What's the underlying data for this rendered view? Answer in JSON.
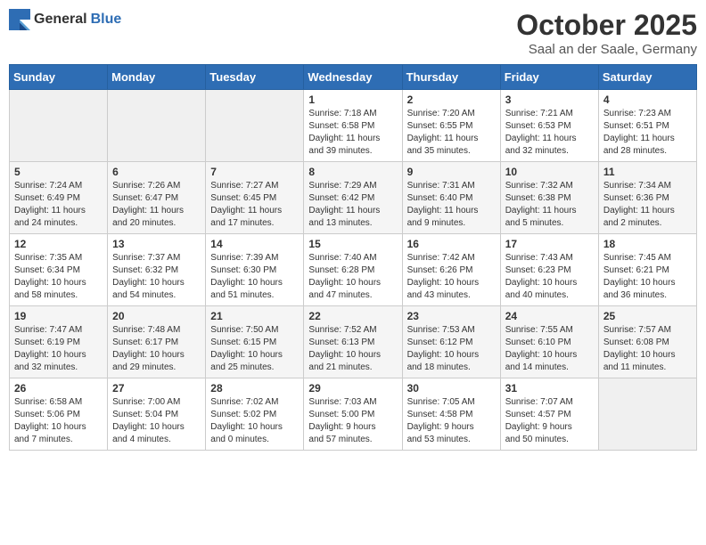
{
  "header": {
    "logo_general": "General",
    "logo_blue": "Blue",
    "month": "October 2025",
    "location": "Saal an der Saale, Germany"
  },
  "weekdays": [
    "Sunday",
    "Monday",
    "Tuesday",
    "Wednesday",
    "Thursday",
    "Friday",
    "Saturday"
  ],
  "weeks": [
    [
      {
        "day": "",
        "info": ""
      },
      {
        "day": "",
        "info": ""
      },
      {
        "day": "",
        "info": ""
      },
      {
        "day": "1",
        "info": "Sunrise: 7:18 AM\nSunset: 6:58 PM\nDaylight: 11 hours\nand 39 minutes."
      },
      {
        "day": "2",
        "info": "Sunrise: 7:20 AM\nSunset: 6:55 PM\nDaylight: 11 hours\nand 35 minutes."
      },
      {
        "day": "3",
        "info": "Sunrise: 7:21 AM\nSunset: 6:53 PM\nDaylight: 11 hours\nand 32 minutes."
      },
      {
        "day": "4",
        "info": "Sunrise: 7:23 AM\nSunset: 6:51 PM\nDaylight: 11 hours\nand 28 minutes."
      }
    ],
    [
      {
        "day": "5",
        "info": "Sunrise: 7:24 AM\nSunset: 6:49 PM\nDaylight: 11 hours\nand 24 minutes."
      },
      {
        "day": "6",
        "info": "Sunrise: 7:26 AM\nSunset: 6:47 PM\nDaylight: 11 hours\nand 20 minutes."
      },
      {
        "day": "7",
        "info": "Sunrise: 7:27 AM\nSunset: 6:45 PM\nDaylight: 11 hours\nand 17 minutes."
      },
      {
        "day": "8",
        "info": "Sunrise: 7:29 AM\nSunset: 6:42 PM\nDaylight: 11 hours\nand 13 minutes."
      },
      {
        "day": "9",
        "info": "Sunrise: 7:31 AM\nSunset: 6:40 PM\nDaylight: 11 hours\nand 9 minutes."
      },
      {
        "day": "10",
        "info": "Sunrise: 7:32 AM\nSunset: 6:38 PM\nDaylight: 11 hours\nand 5 minutes."
      },
      {
        "day": "11",
        "info": "Sunrise: 7:34 AM\nSunset: 6:36 PM\nDaylight: 11 hours\nand 2 minutes."
      }
    ],
    [
      {
        "day": "12",
        "info": "Sunrise: 7:35 AM\nSunset: 6:34 PM\nDaylight: 10 hours\nand 58 minutes."
      },
      {
        "day": "13",
        "info": "Sunrise: 7:37 AM\nSunset: 6:32 PM\nDaylight: 10 hours\nand 54 minutes."
      },
      {
        "day": "14",
        "info": "Sunrise: 7:39 AM\nSunset: 6:30 PM\nDaylight: 10 hours\nand 51 minutes."
      },
      {
        "day": "15",
        "info": "Sunrise: 7:40 AM\nSunset: 6:28 PM\nDaylight: 10 hours\nand 47 minutes."
      },
      {
        "day": "16",
        "info": "Sunrise: 7:42 AM\nSunset: 6:26 PM\nDaylight: 10 hours\nand 43 minutes."
      },
      {
        "day": "17",
        "info": "Sunrise: 7:43 AM\nSunset: 6:23 PM\nDaylight: 10 hours\nand 40 minutes."
      },
      {
        "day": "18",
        "info": "Sunrise: 7:45 AM\nSunset: 6:21 PM\nDaylight: 10 hours\nand 36 minutes."
      }
    ],
    [
      {
        "day": "19",
        "info": "Sunrise: 7:47 AM\nSunset: 6:19 PM\nDaylight: 10 hours\nand 32 minutes."
      },
      {
        "day": "20",
        "info": "Sunrise: 7:48 AM\nSunset: 6:17 PM\nDaylight: 10 hours\nand 29 minutes."
      },
      {
        "day": "21",
        "info": "Sunrise: 7:50 AM\nSunset: 6:15 PM\nDaylight: 10 hours\nand 25 minutes."
      },
      {
        "day": "22",
        "info": "Sunrise: 7:52 AM\nSunset: 6:13 PM\nDaylight: 10 hours\nand 21 minutes."
      },
      {
        "day": "23",
        "info": "Sunrise: 7:53 AM\nSunset: 6:12 PM\nDaylight: 10 hours\nand 18 minutes."
      },
      {
        "day": "24",
        "info": "Sunrise: 7:55 AM\nSunset: 6:10 PM\nDaylight: 10 hours\nand 14 minutes."
      },
      {
        "day": "25",
        "info": "Sunrise: 7:57 AM\nSunset: 6:08 PM\nDaylight: 10 hours\nand 11 minutes."
      }
    ],
    [
      {
        "day": "26",
        "info": "Sunrise: 6:58 AM\nSunset: 5:06 PM\nDaylight: 10 hours\nand 7 minutes."
      },
      {
        "day": "27",
        "info": "Sunrise: 7:00 AM\nSunset: 5:04 PM\nDaylight: 10 hours\nand 4 minutes."
      },
      {
        "day": "28",
        "info": "Sunrise: 7:02 AM\nSunset: 5:02 PM\nDaylight: 10 hours\nand 0 minutes."
      },
      {
        "day": "29",
        "info": "Sunrise: 7:03 AM\nSunset: 5:00 PM\nDaylight: 9 hours\nand 57 minutes."
      },
      {
        "day": "30",
        "info": "Sunrise: 7:05 AM\nSunset: 4:58 PM\nDaylight: 9 hours\nand 53 minutes."
      },
      {
        "day": "31",
        "info": "Sunrise: 7:07 AM\nSunset: 4:57 PM\nDaylight: 9 hours\nand 50 minutes."
      },
      {
        "day": "",
        "info": ""
      }
    ]
  ]
}
